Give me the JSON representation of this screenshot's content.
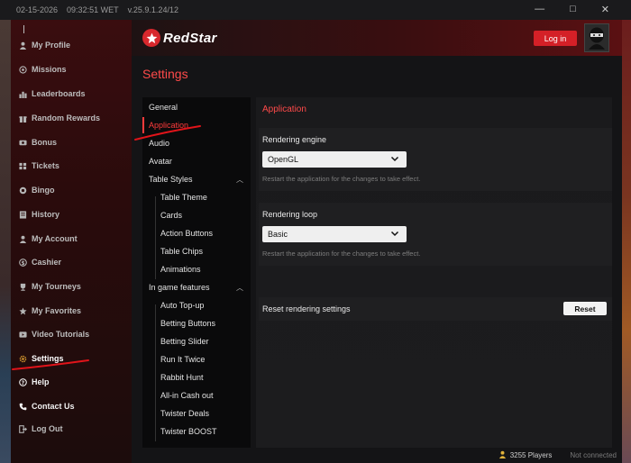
{
  "titlebar": {
    "date": "02-15-2026",
    "time": "09:32:51 WET",
    "version": "v.25.9.1.24/12",
    "min_glyph": "—",
    "max_glyph": "□",
    "close_glyph": "✕"
  },
  "sidebar": {
    "items": [
      {
        "label": "My Profile",
        "icon": "user-icon"
      },
      {
        "label": "Missions",
        "icon": "target-icon"
      },
      {
        "label": "Leaderboards",
        "icon": "leaderboard-icon"
      },
      {
        "label": "Random Rewards",
        "icon": "gift-icon"
      },
      {
        "label": "Bonus",
        "icon": "bonus-icon"
      },
      {
        "label": "Tickets",
        "icon": "ticket-icon"
      },
      {
        "label": "Bingo",
        "icon": "bingo-icon"
      },
      {
        "label": "History",
        "icon": "history-icon"
      },
      {
        "label": "My Account",
        "icon": "account-icon"
      },
      {
        "label": "Cashier",
        "icon": "cashier-icon"
      },
      {
        "label": "My Tourneys",
        "icon": "trophy-icon"
      },
      {
        "label": "My Favorites",
        "icon": "star-icon"
      },
      {
        "label": "Video Tutorials",
        "icon": "video-icon"
      },
      {
        "label": "Settings",
        "icon": "gear-icon"
      },
      {
        "label": "Help",
        "icon": "help-icon"
      },
      {
        "label": "Contact Us",
        "icon": "phone-icon"
      },
      {
        "label": "Log Out",
        "icon": "logout-icon"
      }
    ]
  },
  "header": {
    "brand": "RedStar",
    "login_label": "Log in"
  },
  "page_title": "Settings",
  "settings_menu": {
    "items": [
      {
        "label": "General",
        "level": 0
      },
      {
        "label": "Application",
        "level": 0,
        "active": true
      },
      {
        "label": "Audio",
        "level": 0
      },
      {
        "label": "Avatar",
        "level": 0
      },
      {
        "label": "Table Styles",
        "level": 0,
        "expanded": true
      },
      {
        "label": "Table Theme",
        "level": 1
      },
      {
        "label": "Cards",
        "level": 1
      },
      {
        "label": "Action Buttons",
        "level": 1
      },
      {
        "label": "Table Chips",
        "level": 1
      },
      {
        "label": "Animations",
        "level": 1
      },
      {
        "label": "In game features",
        "level": 0,
        "expanded": true
      },
      {
        "label": "Auto Top-up",
        "level": 1
      },
      {
        "label": "Betting Buttons",
        "level": 1
      },
      {
        "label": "Betting Slider",
        "level": 1
      },
      {
        "label": "Run It Twice",
        "level": 1
      },
      {
        "label": "Rabbit Hunt",
        "level": 1
      },
      {
        "label": "All-in Cash out",
        "level": 1
      },
      {
        "label": "Twister Deals",
        "level": 1
      },
      {
        "label": "Twister BOOST",
        "level": 1
      }
    ]
  },
  "application": {
    "section_title": "Application",
    "rendering_engine": {
      "label": "Rendering engine",
      "value": "OpenGL",
      "hint": "Restart the application for the changes to take effect."
    },
    "rendering_loop": {
      "label": "Rendering loop",
      "value": "Basic",
      "hint": "Restart the application for the changes to take effect."
    },
    "reset": {
      "label": "Reset rendering settings",
      "button": "Reset"
    }
  },
  "status": {
    "players": "3255 Players",
    "connection": "Not connected"
  },
  "colors": {
    "accent": "#ff3b3b",
    "login_bg": "#d42027"
  }
}
